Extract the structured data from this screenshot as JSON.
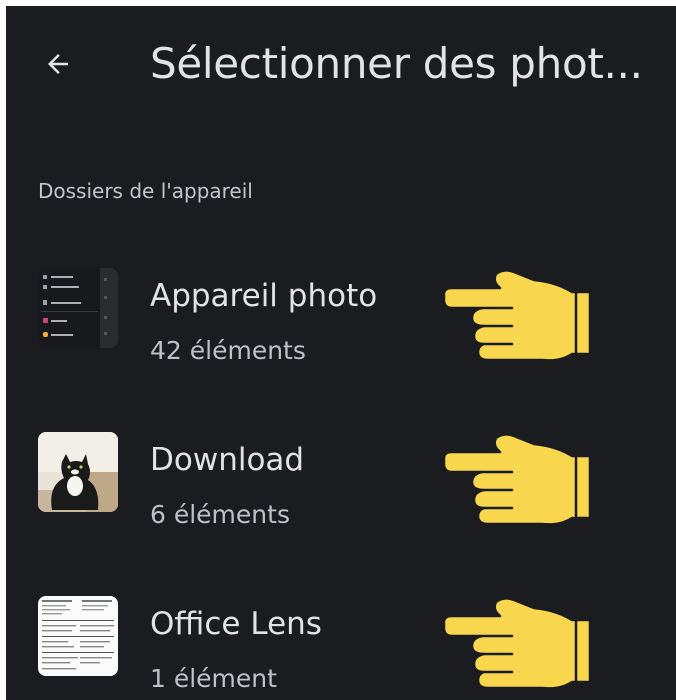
{
  "header": {
    "back_icon": "arrow-left-icon",
    "title": "Sélectionner des phot..."
  },
  "section": {
    "label": "Dossiers de l'appareil"
  },
  "folders": [
    {
      "name": "Appareil photo",
      "count": "42 éléments",
      "thumbnail": "screenshot-thumbnail"
    },
    {
      "name": "Download",
      "count": "6 éléments",
      "thumbnail": "cat-photo-thumbnail"
    },
    {
      "name": "Office Lens",
      "count": "1 élément",
      "thumbnail": "document-thumbnail"
    }
  ],
  "annotations": {
    "pointer_icon": "pointing-hand-icon",
    "pointer_color": "#f8d64e"
  },
  "colors": {
    "background": "#1b1c1f",
    "text_primary": "#e3e3e6",
    "text_secondary": "#bfc1c7"
  }
}
